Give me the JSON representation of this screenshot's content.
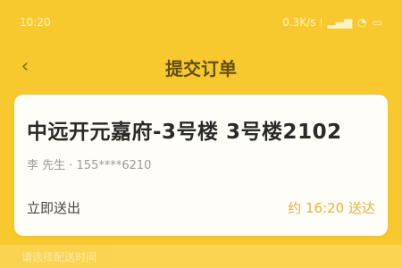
{
  "status_bar": {
    "time": "10:20",
    "network_speed": "0.3K/s",
    "icons": [
      "signal-icon",
      "wifi-icon",
      "battery-icon"
    ]
  },
  "nav": {
    "back_icon": "chevron-left-icon",
    "title": "提交订单"
  },
  "order": {
    "location": "中远开元嘉府-3号楼 3号楼2102",
    "contact": "李 先生 · 155****6210",
    "row_left": "立即送出",
    "row_right": "约 16:20 送达"
  },
  "bottom": {
    "hint": "请选择配送时间"
  },
  "colors": {
    "accent": "#f8c92e",
    "card_bg": "#fffdf7",
    "highlight": "#e6b23d"
  }
}
